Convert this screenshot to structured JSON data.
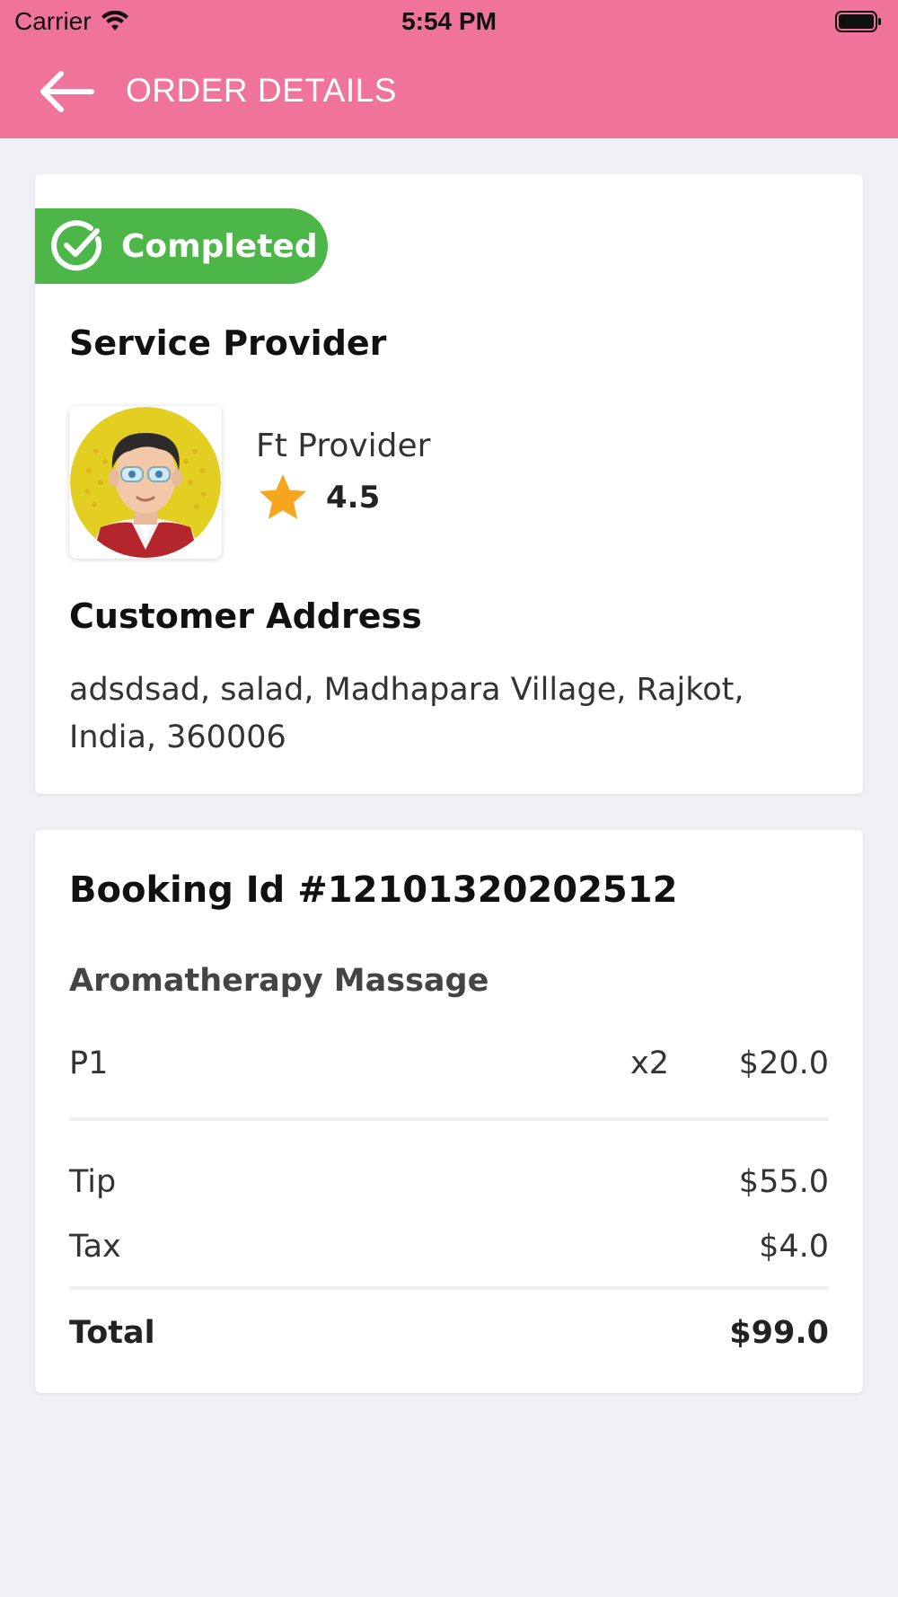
{
  "status_bar": {
    "carrier": "Carrier",
    "time": "5:54 PM"
  },
  "header": {
    "title": "ORDER DETAILS",
    "bg_color": "#f07499",
    "back_icon": "arrow-left-icon"
  },
  "order": {
    "status": "Completed",
    "status_color": "#4cb648",
    "provider_section_title": "Service Provider",
    "provider": {
      "name": "Ft Provider",
      "rating": "4.5"
    },
    "address_section_title": "Customer Address",
    "address": "adsdsad, salad, Madhapara Village, Rajkot, India, 360006"
  },
  "booking": {
    "id_label": "Booking Id #12101320202512",
    "service_name": "Aromatherapy Massage",
    "item": {
      "name": "P1",
      "qty": "x2",
      "price": "$20.0"
    },
    "tip": {
      "label": "Tip",
      "value": "$55.0"
    },
    "tax": {
      "label": "Tax",
      "value": "$4.0"
    },
    "total": {
      "label": "Total",
      "value": "$99.0"
    }
  }
}
